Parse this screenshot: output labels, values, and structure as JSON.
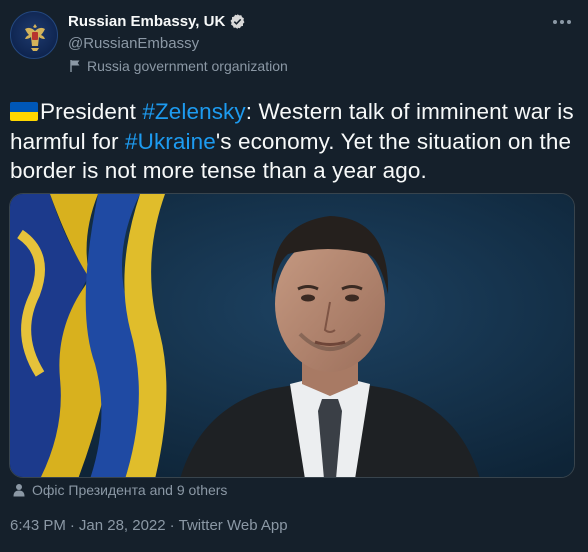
{
  "account": {
    "display_name": "Russian Embassy, UK",
    "handle": "@RussianEmbassy",
    "label": "Russia government organization",
    "avatar_icon": "coat-of-arms-icon",
    "verified_icon": "verified-badge-icon"
  },
  "tweet": {
    "flag_emoji": "ukraine-flag",
    "text_part1": "President ",
    "hashtag1": "#Zelensky",
    "text_part2": ": Western talk of imminent war is harmful for ",
    "hashtag2": "#Ukraine",
    "text_part3": "'s economy. Yet the situation on the border is not more tense than a year ago."
  },
  "media": {
    "alt": "Portrait of a man in a dark suit in front of a blue and yellow flag"
  },
  "tagged": {
    "text": "Офіс Президента and 9 others"
  },
  "meta": {
    "time": "6:43 PM",
    "sep1": "·",
    "date": "Jan 28, 2022",
    "sep2": "·",
    "source": "Twitter Web App"
  },
  "colors": {
    "background": "#15202b",
    "text": "#f7f9f9",
    "secondary": "#8b98a5",
    "link": "#1d9bf0",
    "flag_blue": "#0057b7",
    "flag_yellow": "#ffd700"
  }
}
